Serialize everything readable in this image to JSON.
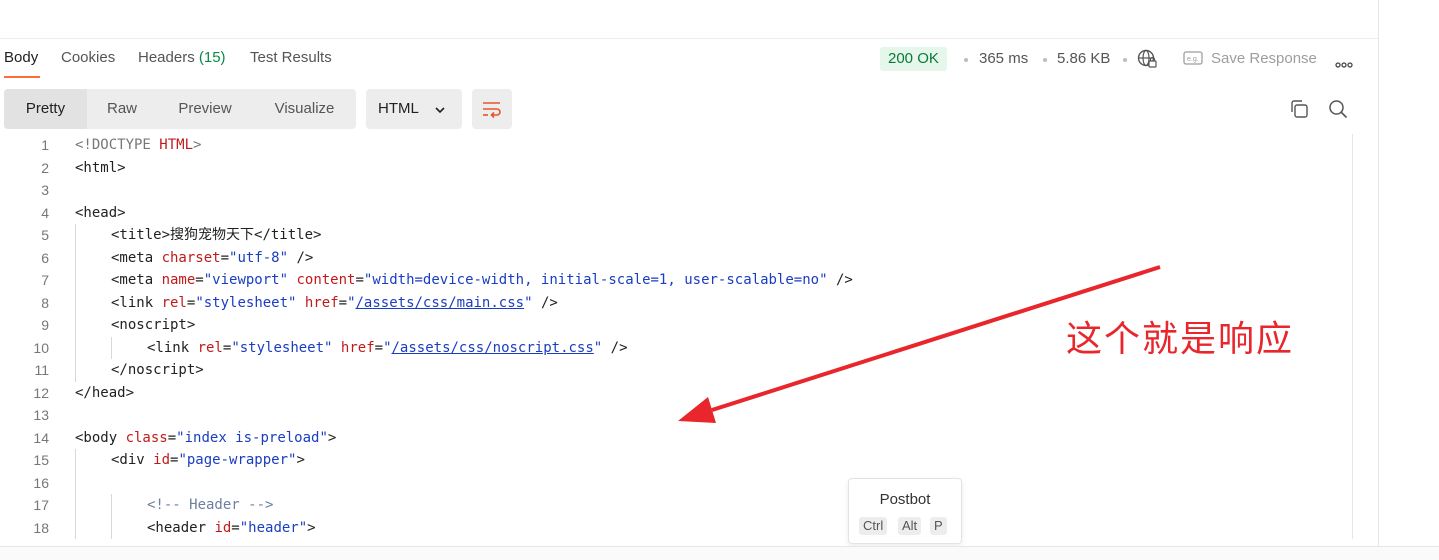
{
  "tabs": [
    {
      "label": "Body"
    },
    {
      "label": "Cookies"
    },
    {
      "label": "Headers",
      "count": "(15)"
    },
    {
      "label": "Test Results"
    }
  ],
  "response": {
    "status": "200 OK",
    "time": "365 ms",
    "size": "5.86 KB",
    "save_label": "Save Response"
  },
  "view_modes": [
    "Pretty",
    "Raw",
    "Preview",
    "Visualize"
  ],
  "language": "HTML",
  "annotation": "这个就是响应",
  "postbot": {
    "title": "Postbot",
    "keys": [
      "Ctrl",
      "Alt",
      "P"
    ]
  },
  "code_lines": [
    {
      "n": "1",
      "indent": 0,
      "tokens": [
        {
          "c": "doct",
          "t": "<!DOCTYPE "
        },
        {
          "c": "attr",
          "t": "HTML"
        },
        {
          "c": "doct",
          "t": ">"
        }
      ]
    },
    {
      "n": "2",
      "indent": 0,
      "tokens": [
        {
          "c": "tag",
          "t": "<html>"
        }
      ]
    },
    {
      "n": "3",
      "indent": 0,
      "tokens": []
    },
    {
      "n": "4",
      "indent": 0,
      "tokens": [
        {
          "c": "tag",
          "t": "<head>"
        }
      ]
    },
    {
      "n": "5",
      "indent": 1,
      "tokens": [
        {
          "c": "tag",
          "t": "<title>"
        },
        {
          "c": "tag",
          "t": "搜狗宠物天下"
        },
        {
          "c": "tag",
          "t": "</title>"
        }
      ]
    },
    {
      "n": "6",
      "indent": 1,
      "tokens": [
        {
          "c": "tag",
          "t": "<meta "
        },
        {
          "c": "attr",
          "t": "charset"
        },
        {
          "c": "tag",
          "t": "="
        },
        {
          "c": "str",
          "t": "\"utf-8\""
        },
        {
          "c": "tag",
          "t": " />"
        }
      ]
    },
    {
      "n": "7",
      "indent": 1,
      "tokens": [
        {
          "c": "tag",
          "t": "<meta "
        },
        {
          "c": "attr",
          "t": "name"
        },
        {
          "c": "tag",
          "t": "="
        },
        {
          "c": "str",
          "t": "\"viewport\""
        },
        {
          "c": "tag",
          "t": " "
        },
        {
          "c": "attr",
          "t": "content"
        },
        {
          "c": "tag",
          "t": "="
        },
        {
          "c": "str",
          "t": "\"width=device-width, initial-scale=1, user-scalable=no\""
        },
        {
          "c": "tag",
          "t": " />"
        }
      ]
    },
    {
      "n": "8",
      "indent": 1,
      "tokens": [
        {
          "c": "tag",
          "t": "<link "
        },
        {
          "c": "attr",
          "t": "rel"
        },
        {
          "c": "tag",
          "t": "="
        },
        {
          "c": "str",
          "t": "\"stylesheet\""
        },
        {
          "c": "tag",
          "t": " "
        },
        {
          "c": "attr",
          "t": "href"
        },
        {
          "c": "tag",
          "t": "="
        },
        {
          "c": "str",
          "t": "\""
        },
        {
          "c": "link",
          "t": "/assets/css/main.css"
        },
        {
          "c": "str",
          "t": "\""
        },
        {
          "c": "tag",
          "t": " />"
        }
      ]
    },
    {
      "n": "9",
      "indent": 1,
      "tokens": [
        {
          "c": "tag",
          "t": "<noscript>"
        }
      ]
    },
    {
      "n": "10",
      "indent": 2,
      "tokens": [
        {
          "c": "tag",
          "t": "<link "
        },
        {
          "c": "attr",
          "t": "rel"
        },
        {
          "c": "tag",
          "t": "="
        },
        {
          "c": "str",
          "t": "\"stylesheet\""
        },
        {
          "c": "tag",
          "t": " "
        },
        {
          "c": "attr",
          "t": "href"
        },
        {
          "c": "tag",
          "t": "="
        },
        {
          "c": "str",
          "t": "\""
        },
        {
          "c": "link",
          "t": "/assets/css/noscript.css"
        },
        {
          "c": "str",
          "t": "\""
        },
        {
          "c": "tag",
          "t": " />"
        }
      ]
    },
    {
      "n": "11",
      "indent": 1,
      "tokens": [
        {
          "c": "tag",
          "t": "</noscript>"
        }
      ]
    },
    {
      "n": "12",
      "indent": 0,
      "tokens": [
        {
          "c": "tag",
          "t": "</head>"
        }
      ]
    },
    {
      "n": "13",
      "indent": 0,
      "tokens": []
    },
    {
      "n": "14",
      "indent": 0,
      "tokens": [
        {
          "c": "tag",
          "t": "<body "
        },
        {
          "c": "attr",
          "t": "class"
        },
        {
          "c": "tag",
          "t": "="
        },
        {
          "c": "str",
          "t": "\"index is-preload\""
        },
        {
          "c": "tag",
          "t": ">"
        }
      ]
    },
    {
      "n": "15",
      "indent": 1,
      "tokens": [
        {
          "c": "tag",
          "t": "<div "
        },
        {
          "c": "attr",
          "t": "id"
        },
        {
          "c": "tag",
          "t": "="
        },
        {
          "c": "str",
          "t": "\"page-wrapper\""
        },
        {
          "c": "tag",
          "t": ">"
        }
      ]
    },
    {
      "n": "16",
      "indent": 1,
      "tokens": []
    },
    {
      "n": "17",
      "indent": 2,
      "tokens": [
        {
          "c": "cmt",
          "t": "<!-- Header -->"
        }
      ]
    },
    {
      "n": "18",
      "indent": 2,
      "tokens": [
        {
          "c": "tag",
          "t": "<header "
        },
        {
          "c": "attr",
          "t": "id"
        },
        {
          "c": "tag",
          "t": "="
        },
        {
          "c": "str",
          "t": "\"header\""
        },
        {
          "c": "tag",
          "t": ">"
        }
      ]
    }
  ]
}
